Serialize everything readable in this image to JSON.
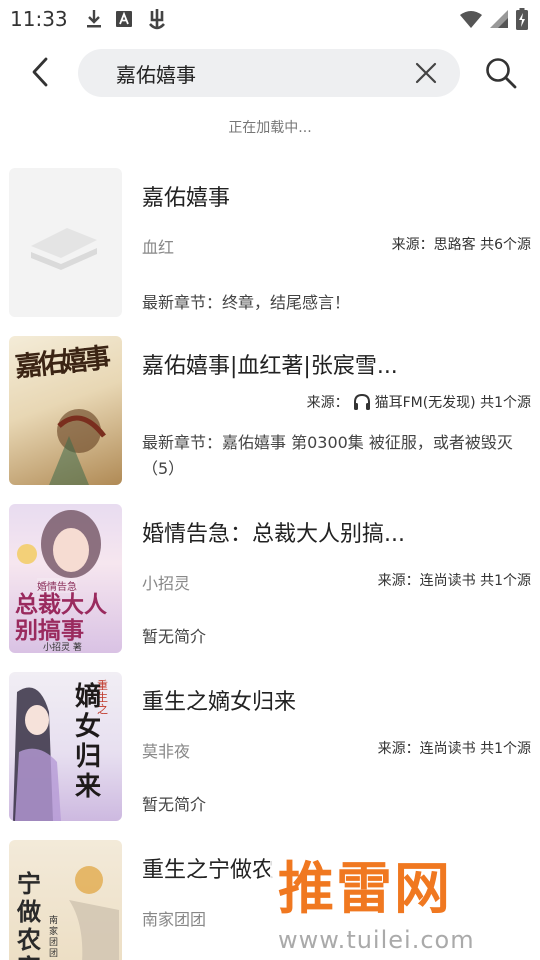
{
  "status_bar": {
    "time": "11:33",
    "icons": [
      "download-icon",
      "a-box-icon",
      "bug-icon",
      "wifi-icon",
      "signal-icon",
      "battery-icon"
    ]
  },
  "search": {
    "value": "嘉佑嬉事"
  },
  "loading_text": "正在加载中...",
  "results": [
    {
      "title": "嘉佑嬉事",
      "author": "血红",
      "source": "来源：思路客 共6个源",
      "latest": "最新章节：终章，结尾感言！",
      "cover": "placeholder"
    },
    {
      "title": "嘉佑嬉事|血红著|张宸雪...",
      "author": "",
      "source_prefix": "来源：",
      "source": "猫耳FM(无发现) 共1个源",
      "latest": "最新章节：嘉佑嬉事 第0300集 被征服，或者被毁灭（5）",
      "cover": "image",
      "cover_text": "嘉佑嬉事"
    },
    {
      "title": "婚情告急：总裁大人别搞...",
      "author": "小招灵",
      "source": "来源：连尚读书 共1个源",
      "latest": "暂无简介",
      "cover": "image",
      "cover_text": "总裁大人别搞事",
      "cover_small": "婚情告急",
      "cover_author": "小招灵 著"
    },
    {
      "title": "重生之嫡女归来",
      "author": "莫非夜",
      "source": "来源：连尚读书 共1个源",
      "latest": "暂无简介",
      "cover": "image",
      "cover_text": "嫡女归来",
      "cover_small": "重生之"
    },
    {
      "title": "重生之宁做农",
      "author": "南家团团",
      "source": "",
      "latest": "",
      "cover": "image",
      "cover_text": "宁做农家",
      "cover_author": "南家团团"
    }
  ],
  "watermark": {
    "brand": "推雷网",
    "url": "www.tuilei.com"
  },
  "colors": {
    "search_bg": "#eeeff1",
    "watermark_orange": "#f07820"
  }
}
